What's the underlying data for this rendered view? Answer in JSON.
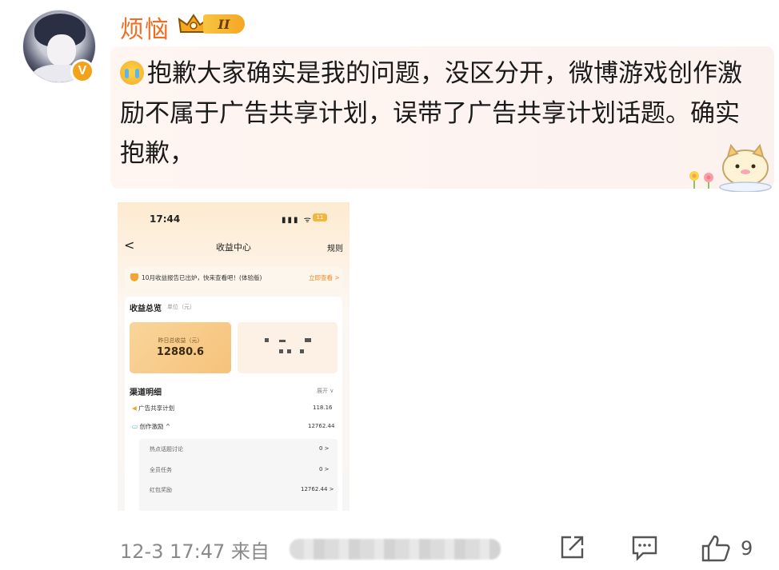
{
  "user": {
    "name": "烦恼",
    "level_badge": "II",
    "verified_badge": "V",
    "name_color": "#f26d21"
  },
  "comment": {
    "emoji": "crying-face-icon",
    "text": "抱歉大家确实是我的问题，没区分开，微博游戏创作激励不属于广告共享计划，误带了广告共享计划话题。确实抱歉，"
  },
  "screenshot": {
    "status_time": "17:44",
    "status_icons": "▮▮▮ ᯤ",
    "battery": "11",
    "back": "<",
    "title": "收益中心",
    "rules": "规则",
    "notice": "10月收益报告已出炉，快来查看吧！(体验版)",
    "notice_link": "立即查看 >",
    "overview_title": "收益总览",
    "overview_unit": "单位（元）",
    "yesterday_label": "昨日总收益（元）",
    "yesterday_value": "12880.6",
    "channel_title": "渠道明细",
    "expand_label": "展开 ∨",
    "rows": [
      {
        "label": "广告共享计划",
        "value": "118.16"
      },
      {
        "label": "创作激励 ^",
        "value": "12762.44"
      }
    ],
    "sub_rows": [
      {
        "label": "热点话题讨论",
        "value": "0 >"
      },
      {
        "label": "全员任务",
        "value": "0 >"
      },
      {
        "label": "红包奖励",
        "value": "12762.44 >"
      }
    ]
  },
  "footer": {
    "timestamp": "12-3 17:47  来自",
    "like_count": "9",
    "actions": [
      "share-icon",
      "comment-icon",
      "like-icon"
    ]
  }
}
